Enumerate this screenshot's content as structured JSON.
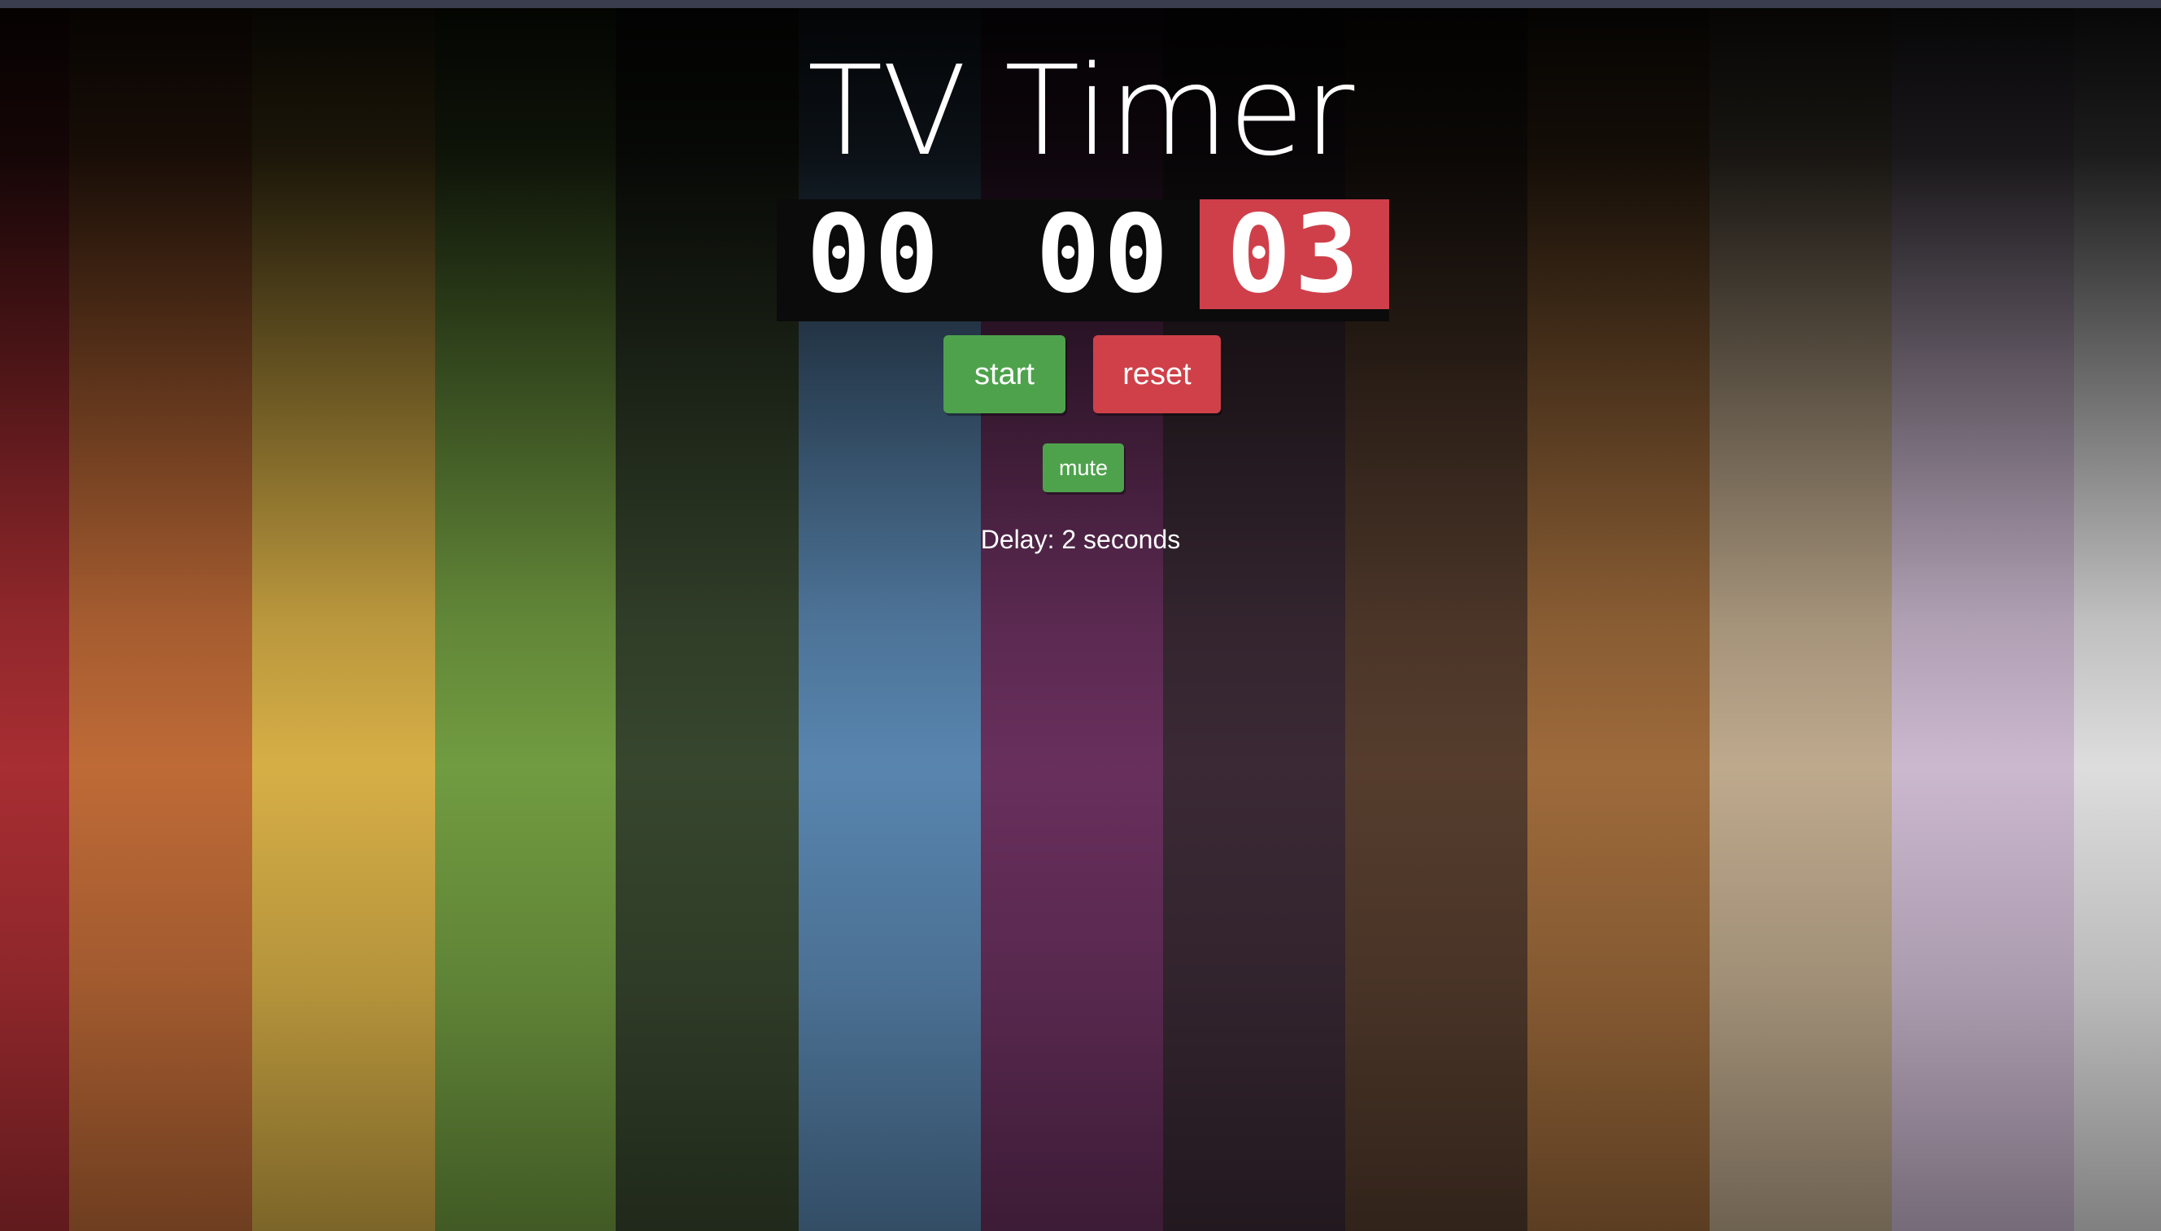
{
  "app": {
    "title": "TV Timer"
  },
  "timer": {
    "hours": "00",
    "minutes": "00",
    "seconds": "03",
    "active_segment_color": "#cf3f4a"
  },
  "controls": {
    "start_label": "start",
    "reset_label": "reset",
    "mute_label": "mute"
  },
  "delay_text": "Delay: 2 seconds",
  "colors": {
    "start": "#4ea24c",
    "reset": "#cf4049",
    "mute": "#4ea24c",
    "stripes": [
      "#b03035",
      "#c9703a",
      "#e2b84a",
      "#77a444",
      "#3a4a30",
      "#5d8cb8",
      "#6e3262",
      "#3e2c38",
      "#5a4030",
      "#a6703e",
      "#c8b294",
      "#d6c2da",
      "#e9e9e9"
    ]
  }
}
